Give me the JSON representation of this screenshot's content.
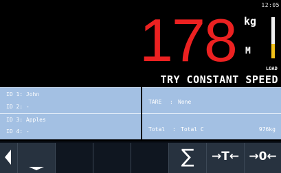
{
  "header": {
    "time": "12:05",
    "weight": "178",
    "unit": "kg",
    "mode": "M",
    "load_label": "LOAD",
    "load_fraction": 0.35,
    "status": "TRY CONSTANT SPEED"
  },
  "ids": [
    "ID 1: John",
    "ID 2: -",
    "ID 3: Apples",
    "ID 4: -"
  ],
  "tare": {
    "label": "TARE",
    "separator": ":",
    "value": "None"
  },
  "total": {
    "label": "Total",
    "separator": ":",
    "name": "Total C",
    "amount": "976kg"
  },
  "softkeys": {
    "sum_symbol": "∑",
    "tare_symbol": "→T←",
    "zero_symbol": "→0←"
  },
  "colors": {
    "weight": "#ec2121",
    "panel": "#a3c0e3",
    "load_fill": "#f2c21a"
  }
}
